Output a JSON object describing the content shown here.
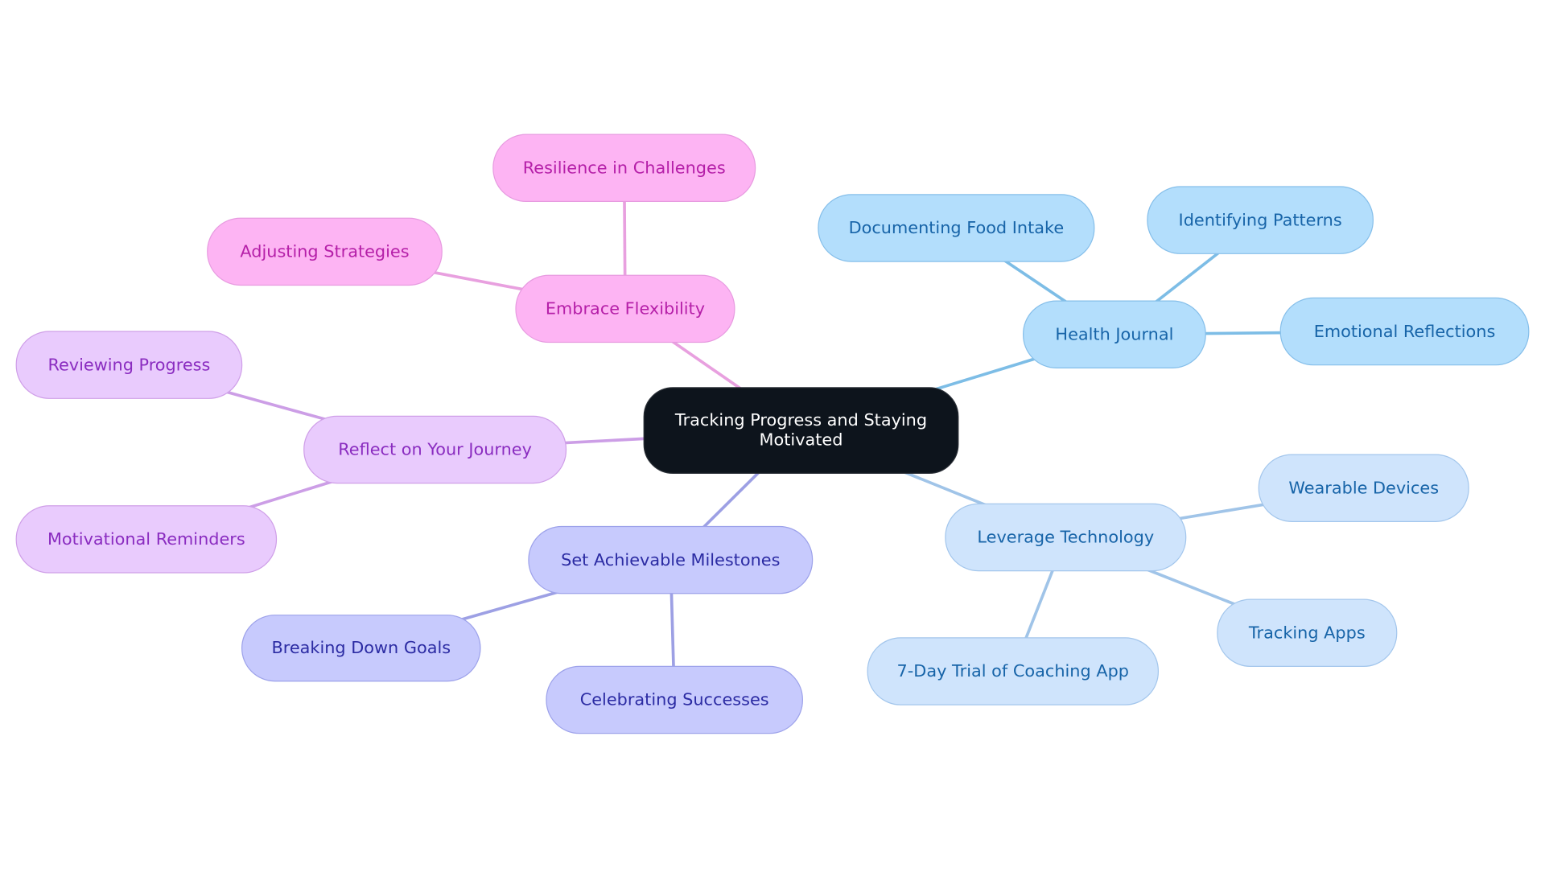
{
  "diagram": {
    "type": "mind-map",
    "root": {
      "id": "root",
      "label": "Tracking Progress and Staying Motivated"
    },
    "branches": [
      {
        "id": "embrace",
        "label": "Embrace Flexibility",
        "theme": "pink",
        "edge_color": "#e8a0df",
        "children": [
          {
            "id": "resilience",
            "label": "Resilience in Challenges"
          },
          {
            "id": "adjusting",
            "label": "Adjusting Strategies"
          }
        ]
      },
      {
        "id": "reflect",
        "label": "Reflect on Your Journey",
        "theme": "violet",
        "edge_color": "#cc9ee6",
        "children": [
          {
            "id": "reviewing",
            "label": "Reviewing Progress"
          },
          {
            "id": "motivational",
            "label": "Motivational Reminders"
          }
        ]
      },
      {
        "id": "milestones",
        "label": "Set Achievable Milestones",
        "theme": "indigo",
        "edge_color": "#9da0e4",
        "children": [
          {
            "id": "breaking",
            "label": "Breaking Down Goals"
          },
          {
            "id": "celebrating",
            "label": "Celebrating Successes"
          }
        ]
      },
      {
        "id": "journal",
        "label": "Health Journal",
        "theme": "sky",
        "edge_color": "#7dbde6",
        "children": [
          {
            "id": "documenting",
            "label": "Documenting Food Intake"
          },
          {
            "id": "patterns",
            "label": "Identifying Patterns"
          },
          {
            "id": "emotional",
            "label": "Emotional Reflections"
          }
        ]
      },
      {
        "id": "technology",
        "label": "Leverage Technology",
        "theme": "pale",
        "edge_color": "#a0c4e8",
        "children": [
          {
            "id": "wearable",
            "label": "Wearable Devices"
          },
          {
            "id": "apps",
            "label": "Tracking Apps"
          },
          {
            "id": "trial",
            "label": "7-Day Trial of Coaching App"
          }
        ]
      }
    ],
    "colors": {
      "root_fill": "#0d141c",
      "root_text": "#ffffff",
      "pink_fill": "#fdb4f3",
      "violet_fill": "#e9cbfd",
      "indigo_fill": "#c7cafd",
      "sky_fill": "#b3defc",
      "pale_fill": "#cfe4fc"
    }
  }
}
